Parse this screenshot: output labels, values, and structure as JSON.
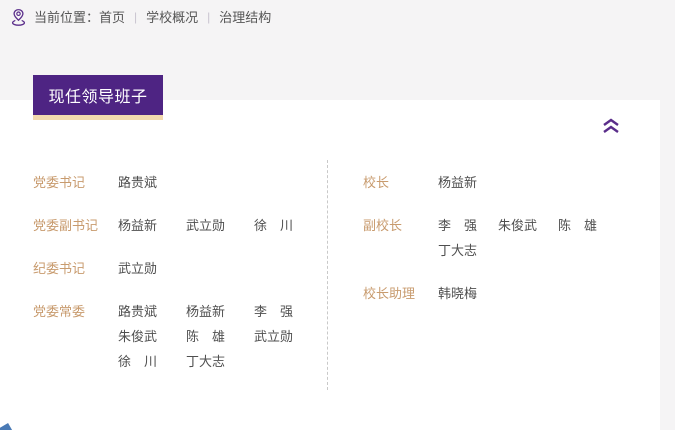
{
  "colors": {
    "primary_purple": "#4e2483",
    "peach_underline": "#f3d9ae",
    "role_label_tan": "#c89b6e",
    "name_text": "#4f4f4f",
    "breadcrumb_text": "#555555",
    "page_background": "#f5f4f5",
    "card_background": "#ffffff",
    "divider_dashed": "#c9c9c9"
  },
  "breadcrumb": {
    "location_label": "当前位置：",
    "separator": "|",
    "items": [
      {
        "label": "首页"
      },
      {
        "label": "学校概况"
      },
      {
        "label": "治理结构"
      }
    ]
  },
  "section": {
    "title": "现任领导班子"
  },
  "leadership": {
    "left": [
      {
        "role": "党委书记",
        "names": [
          "路贵斌"
        ]
      },
      {
        "role": "党委副书记",
        "names": [
          "杨益新",
          "武立勋",
          "徐　川"
        ]
      },
      {
        "role": "纪委书记",
        "names": [
          "武立勋"
        ]
      },
      {
        "role": "党委常委",
        "names": [
          "路贵斌",
          "杨益新",
          "李　强",
          "朱俊武",
          "陈　雄",
          "武立勋",
          "徐　川",
          "丁大志"
        ]
      }
    ],
    "right": [
      {
        "role": "校长",
        "names": [
          "杨益新"
        ]
      },
      {
        "role": "副校长",
        "names": [
          "李　强",
          "朱俊武",
          "陈　雄",
          "丁大志"
        ]
      },
      {
        "role": "校长助理",
        "names": [
          "韩晓梅"
        ]
      }
    ]
  }
}
